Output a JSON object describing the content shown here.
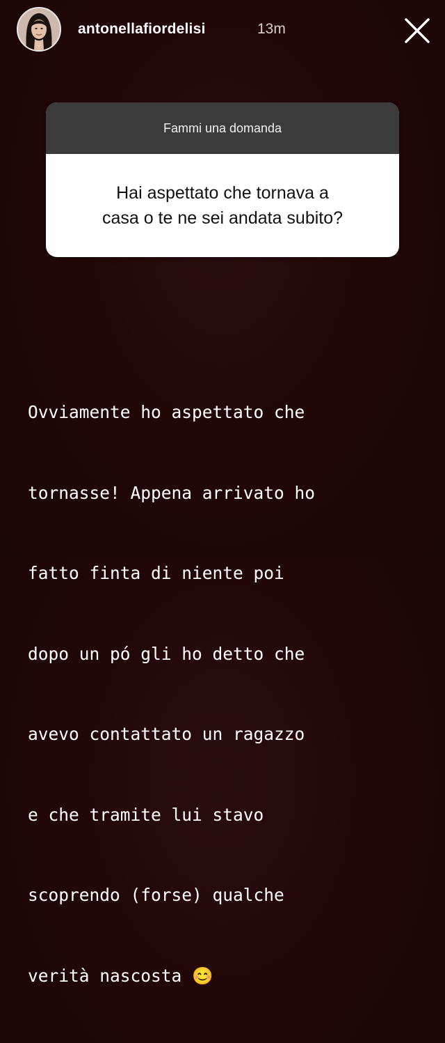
{
  "header": {
    "username": "antonellafiordelisi",
    "time": "13m",
    "close_icon": "close-icon",
    "avatar_icon": "profile-avatar"
  },
  "question_sticker": {
    "title": "Fammi una domanda",
    "question_line1": "Hai aspettato che tornava a",
    "question_line2": "casa o te ne sei andata subito?"
  },
  "answer": {
    "lines": [
      "Ovviamente ho aspettato che",
      "tornasse! Appena arrivato ho",
      "fatto finta di niente poi",
      "dopo un pó gli ho detto che",
      "avevo contattato un ragazzo",
      "e che tramite lui stavo",
      "scoprendo (forse) qualche",
      "verità nascosta 😊"
    ]
  },
  "colors": {
    "background": "#220709",
    "card_header": "#3b3b3b",
    "card_body": "#ffffff",
    "text": "#ffffff"
  }
}
